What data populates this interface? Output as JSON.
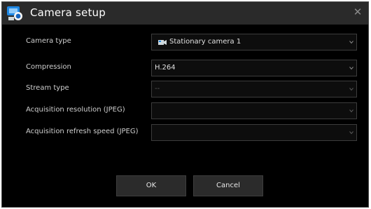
{
  "dialog": {
    "title": "Camera setup",
    "close_icon": "close-icon",
    "title_icon": "camera-setup-icon"
  },
  "fields": [
    {
      "label": "Camera type",
      "value": "Stationary camera 1",
      "enabled": true,
      "icon": "camera-icon"
    },
    {
      "label": "Compression",
      "value": "H.264",
      "enabled": true
    },
    {
      "label": "Stream type",
      "value": "--",
      "enabled": false
    },
    {
      "label": "Acquisition resolution (JPEG)",
      "value": "",
      "enabled": false
    },
    {
      "label": "Acquisition refresh speed (JPEG)",
      "value": "",
      "enabled": false
    }
  ],
  "buttons": {
    "ok_label": "OK",
    "cancel_label": "Cancel"
  },
  "colors": {
    "background": "#000000",
    "titlebar": "#2a2a2a",
    "button": "#2b2b2b",
    "text": "#e0e0e0",
    "field_border": "#3c3c3c"
  }
}
